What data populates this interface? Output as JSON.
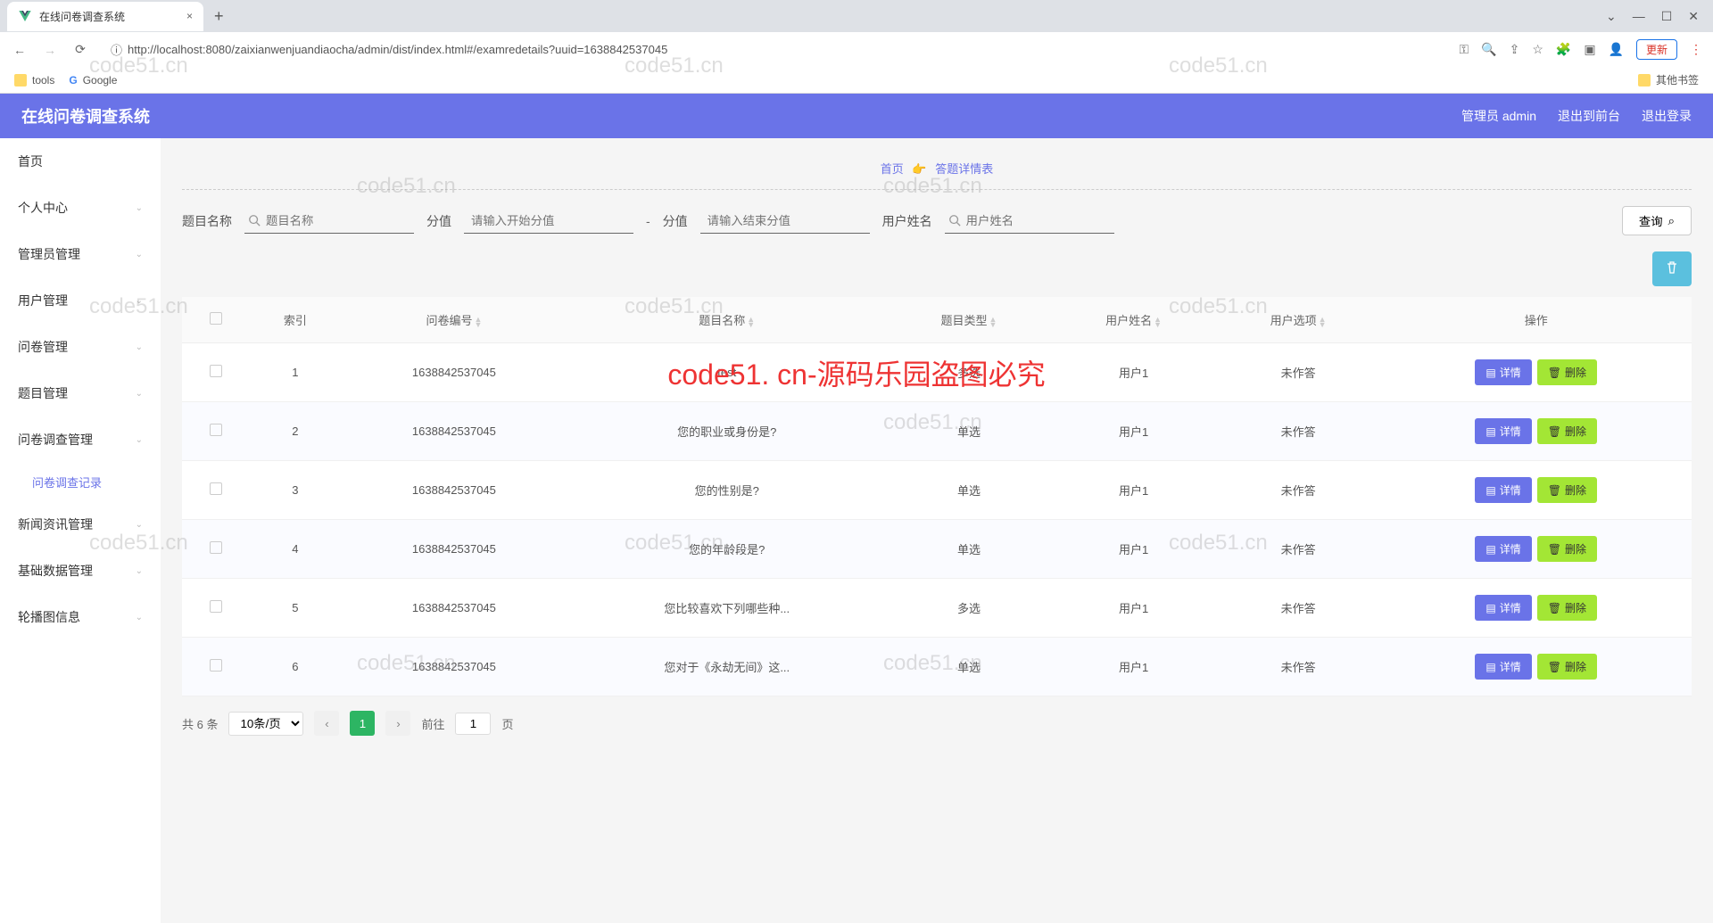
{
  "browser": {
    "tab_title": "在线问卷调查系统",
    "url": "http://localhost:8080/zaixianwenjuandiaocha/admin/dist/index.html#/examredetails?uuid=1638842537045",
    "update_label": "更新",
    "bookmarks": {
      "tools": "tools",
      "google": "Google",
      "other": "其他书签"
    }
  },
  "header": {
    "title": "在线问卷调查系统",
    "user": "管理员 admin",
    "exit_front": "退出到前台",
    "logout": "退出登录"
  },
  "sidebar": {
    "items": [
      "首页",
      "个人中心",
      "管理员管理",
      "用户管理",
      "问卷管理",
      "题目管理",
      "问卷调查管理",
      "新闻资讯管理",
      "基础数据管理",
      "轮播图信息"
    ],
    "sub_survey": "问卷调查记录"
  },
  "breadcrumb": {
    "home": "首页",
    "current": "答题详情表"
  },
  "search": {
    "title_label": "题目名称",
    "title_ph": "题目名称",
    "score_label": "分值",
    "score_start_ph": "请输入开始分值",
    "score_end_ph": "请输入结束分值",
    "user_label": "用户姓名",
    "user_ph": "用户姓名",
    "query_btn": "查询"
  },
  "table": {
    "headers": [
      "索引",
      "问卷编号",
      "题目名称",
      "题目类型",
      "用户姓名",
      "用户选项",
      "操作"
    ],
    "detail_label": "详情",
    "delete_label": "删除",
    "rows": [
      {
        "idx": "1",
        "paper_id": "1638842537045",
        "title": "test",
        "type": "多选",
        "user": "用户1",
        "option": "未作答"
      },
      {
        "idx": "2",
        "paper_id": "1638842537045",
        "title": "您的职业或身份是?",
        "type": "单选",
        "user": "用户1",
        "option": "未作答"
      },
      {
        "idx": "3",
        "paper_id": "1638842537045",
        "title": "您的性别是?",
        "type": "单选",
        "user": "用户1",
        "option": "未作答"
      },
      {
        "idx": "4",
        "paper_id": "1638842537045",
        "title": "您的年龄段是?",
        "type": "单选",
        "user": "用户1",
        "option": "未作答"
      },
      {
        "idx": "5",
        "paper_id": "1638842537045",
        "title": "您比较喜欢下列哪些种...",
        "type": "多选",
        "user": "用户1",
        "option": "未作答"
      },
      {
        "idx": "6",
        "paper_id": "1638842537045",
        "title": "您对于《永劫无间》这...",
        "type": "单选",
        "user": "用户1",
        "option": "未作答"
      }
    ]
  },
  "pagination": {
    "total": "共 6 条",
    "per_page": "10条/页",
    "goto_label": "前往",
    "page_value": "1",
    "page_suffix": "页"
  },
  "watermark_text": "code51.cn",
  "watermark_red": "code51. cn-源码乐园盗图必究"
}
